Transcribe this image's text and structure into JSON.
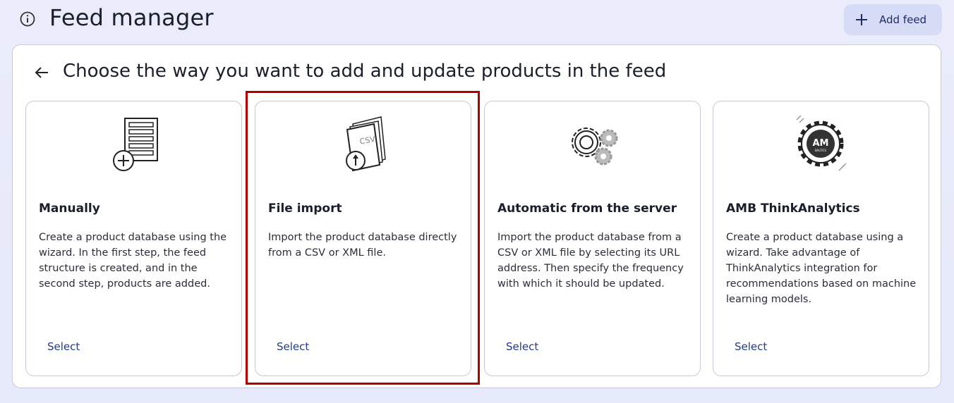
{
  "header": {
    "title": "Feed manager",
    "add_button_label": "Add feed"
  },
  "panel": {
    "title": "Choose the way you want to add and update products in the feed"
  },
  "cards": [
    {
      "title": "Manually",
      "description": "Create a product database using the wizard. In the first step, the feed structure is created, and in the second step, products are added.",
      "select_label": "Select",
      "icon": "document-add-icon"
    },
    {
      "title": "File import",
      "description": "Import the product database directly from a CSV or XML file.",
      "select_label": "Select",
      "icon": "csv-upload-icon",
      "icon_text": "CSV"
    },
    {
      "title": "Automatic from the server",
      "description": "Import the product database from a CSV or XML file by selecting its URL address. Then specify the frequency with which it should be updated.",
      "select_label": "Select",
      "icon": "gears-icon"
    },
    {
      "title": "AMB ThinkAnalytics",
      "description": "Create a product database using a wizard. Take advantage of ThinkAnalytics integration for recommendations based on machine learning models.",
      "select_label": "Select",
      "icon": "amb-gear-logo-icon",
      "icon_text": "AM",
      "icon_subtext": "BALTICS"
    }
  ],
  "colors": {
    "background": "#e8ebfa",
    "accent_button": "#d7dcf6",
    "link": "#233b8c",
    "highlight": "#b00000"
  }
}
